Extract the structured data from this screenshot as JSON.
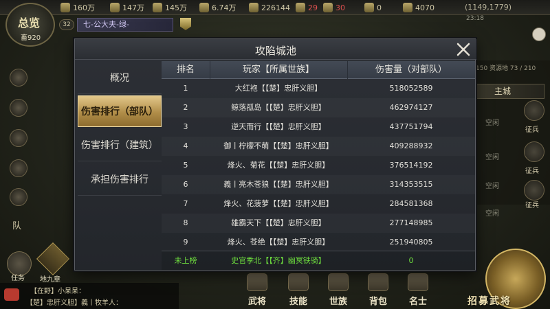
{
  "hud": {
    "overview_title": "总览",
    "overview_value": "畜920",
    "level": "32",
    "rank_banner": "七-公大夫-绿-",
    "coords": "(1149,1779)",
    "clock": "23:18",
    "resources": [
      {
        "icon": "wood-icon",
        "value": "160万"
      },
      {
        "icon": "iron-icon",
        "value": "147万"
      },
      {
        "icon": "stone-icon",
        "value": "145万"
      },
      {
        "icon": "grain-icon",
        "value": "6.74万"
      },
      {
        "icon": "copper-icon",
        "value": "226144"
      },
      {
        "icon": "token-icon",
        "value": "29"
      },
      {
        "icon": "jade-icon",
        "value": "30"
      },
      {
        "icon": "gem-icon",
        "value": "0"
      },
      {
        "icon": "gold-icon",
        "value": "4070"
      }
    ],
    "team_text": "队",
    "task_label": "任务",
    "guide_label": "地九章",
    "chat": {
      "line1": "【在野】小呆呆：",
      "line2": "【楚】忠肝义胆】義丨牧羊人："
    },
    "nav": [
      "武将",
      "技能",
      "世族",
      "背包",
      "名士"
    ],
    "recruit_label": "招募武将",
    "capacity": "150 资源地 73 / 210",
    "main_city": "主城",
    "empty_slots": [
      "空闲",
      "空闲",
      "空闲",
      "空闲"
    ],
    "recruit_small": [
      "征兵",
      "征兵",
      "征兵"
    ]
  },
  "dialog": {
    "title": "攻陷城池",
    "menu": [
      {
        "label": "概况",
        "active": false
      },
      {
        "label": "伤害排行（部队）",
        "active": true
      },
      {
        "label": "伤害排行（建筑）",
        "active": false
      },
      {
        "label": "承担伤害排行",
        "active": false
      }
    ],
    "columns": [
      "排名",
      "玩家【所属世族】",
      "伤害量（对部队）"
    ],
    "rows": [
      {
        "rank": "1",
        "player": "大红袍【【楚】忠肝义胆】",
        "damage": "518052589"
      },
      {
        "rank": "2",
        "player": "鲸落孤岛【【楚】忠肝义胆】",
        "damage": "462974127"
      },
      {
        "rank": "3",
        "player": "逆天而行【【楚】忠肝义胆】",
        "damage": "437751794"
      },
      {
        "rank": "4",
        "player": "御丨柠檬不萌【【楚】忠肝义胆】",
        "damage": "409288932"
      },
      {
        "rank": "5",
        "player": "烽火、菊花【【楚】忠肝义胆】",
        "damage": "376514192"
      },
      {
        "rank": "6",
        "player": "義丨亮木苍狼【【楚】忠肝义胆】",
        "damage": "314353515"
      },
      {
        "rank": "7",
        "player": "烽火、花菠萝【【楚】忠肝义胆】",
        "damage": "284581368"
      },
      {
        "rank": "8",
        "player": "雄霸天下【【楚】忠肝义胆】",
        "damage": "277148985"
      },
      {
        "rank": "9",
        "player": "烽火、苍绝【【楚】忠肝义胆】",
        "damage": "251940805"
      }
    ],
    "self_row": {
      "rank": "未上榜",
      "player": "史官季北【【齐】幽冥铁骑】",
      "damage": "0"
    }
  }
}
